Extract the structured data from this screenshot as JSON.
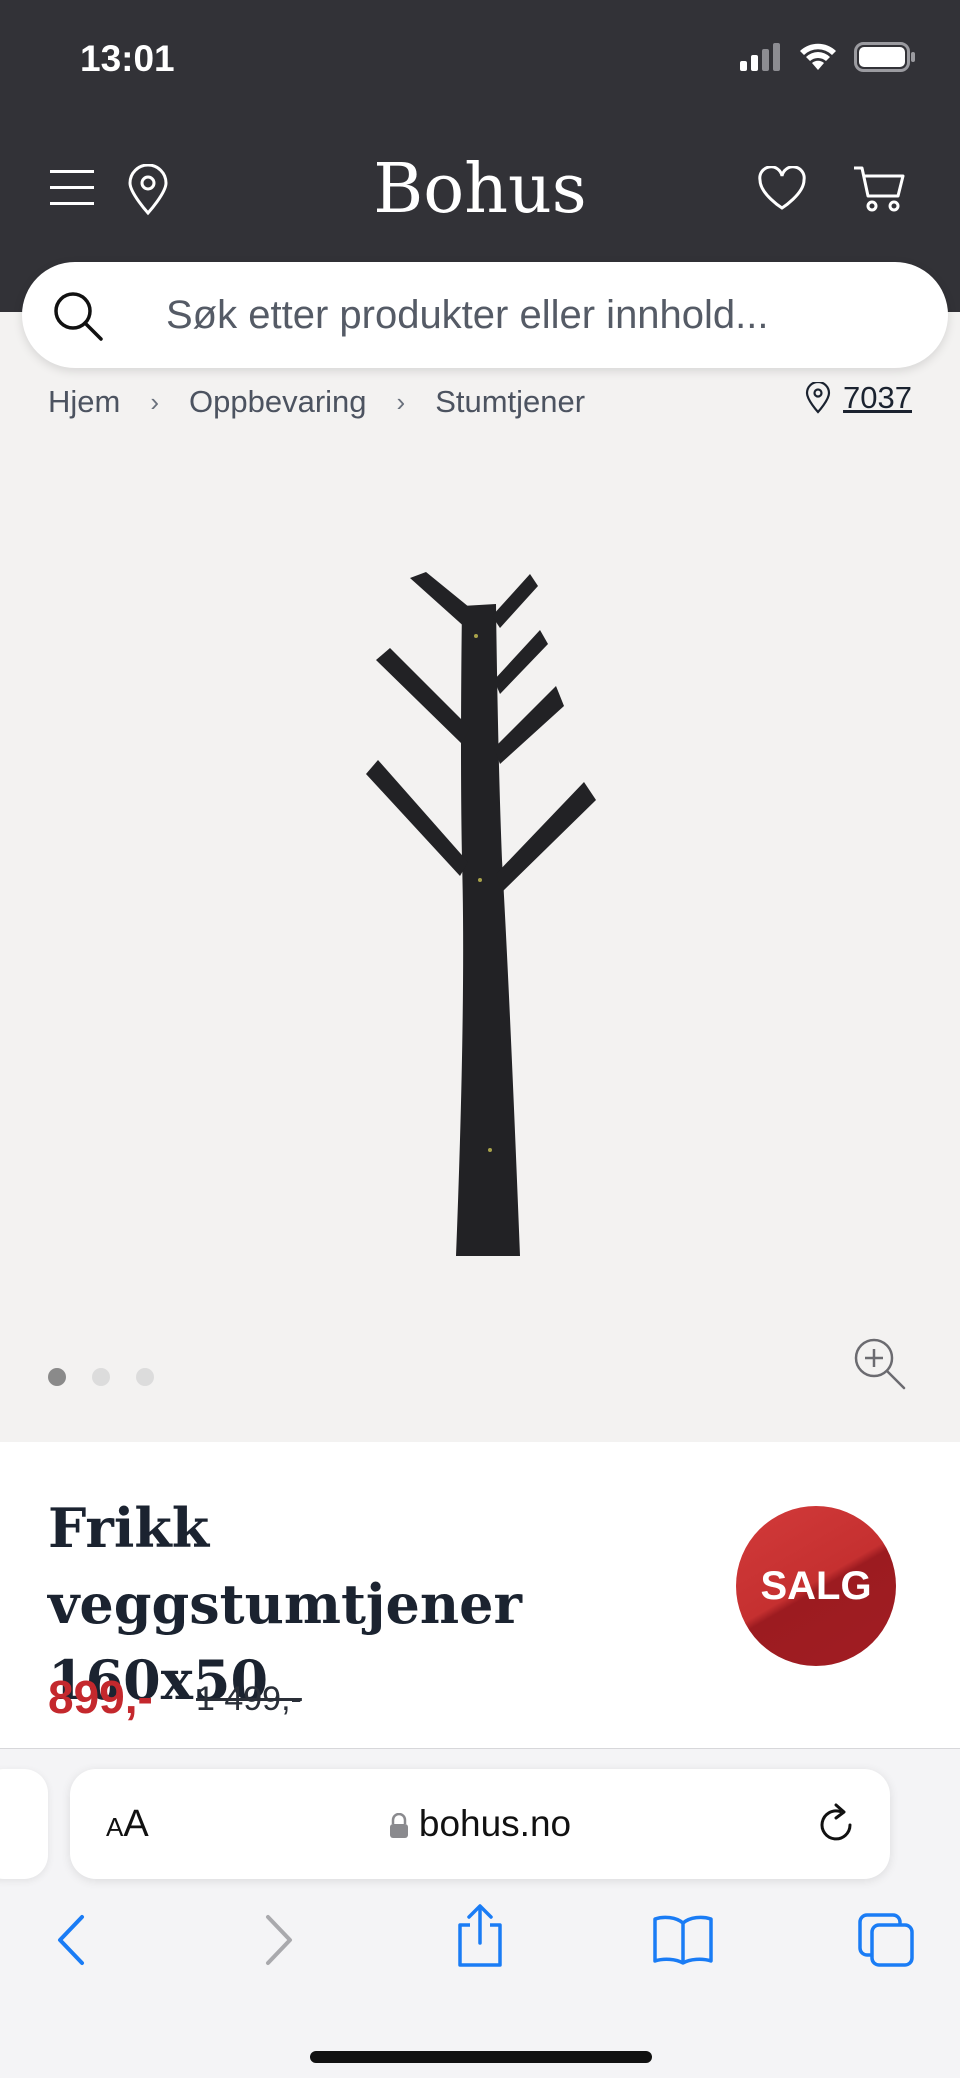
{
  "status_bar": {
    "time": "13:01"
  },
  "header": {
    "brand": "Bohus",
    "icons": [
      "menu-icon",
      "location-pin-icon",
      "heart-icon",
      "cart-icon"
    ]
  },
  "search": {
    "placeholder": "Søk etter produkter eller innhold..."
  },
  "breadcrumb": {
    "items": [
      "Hjem",
      "Oppbevaring",
      "Stumtjener"
    ],
    "separator": "›"
  },
  "store_location": {
    "code": "7037"
  },
  "gallery": {
    "image_count": 3,
    "active_index": 0
  },
  "product": {
    "title_line1": "Frikk veggstumtjener",
    "title_line2": "160x50",
    "badge": "SALG",
    "price": "899,-",
    "old_price": "1 499,-"
  },
  "browser": {
    "aa_small": "A",
    "aa_large": "A",
    "url": "bohus.no"
  },
  "colors": {
    "header_bg": "#323237",
    "sale_red": "#c4282d",
    "ios_blue": "#1a7cf5",
    "ink": "#1b2330"
  }
}
